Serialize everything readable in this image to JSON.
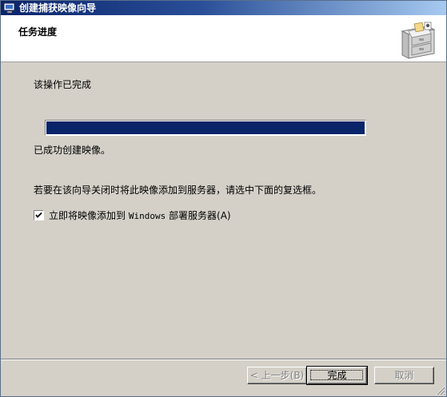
{
  "window": {
    "title": "创建捕获映像向导",
    "icon": "wizard-window-icon"
  },
  "header": {
    "title": "任务进度",
    "icon": "file-cabinet-icon"
  },
  "main": {
    "status": "该操作已完成",
    "progress_value": 1.0,
    "success": "已成功创建映像。",
    "hint": "若要在该向导关闭时将此映像添加到服务器，请选中下面的复选框。",
    "checkbox": {
      "checked": true,
      "label_prefix": "立即将映像添加到",
      "label_product": "Windows",
      "label_suffix": "部署服务器(A)"
    }
  },
  "footer": {
    "back_label": "< 上一步(B)",
    "finish_label": "完成",
    "cancel_label": "取消"
  },
  "colors": {
    "title_gradient_start": "#0a246a",
    "progress_fill": "#0a246a",
    "dialog_bg": "#d4d0c8"
  }
}
